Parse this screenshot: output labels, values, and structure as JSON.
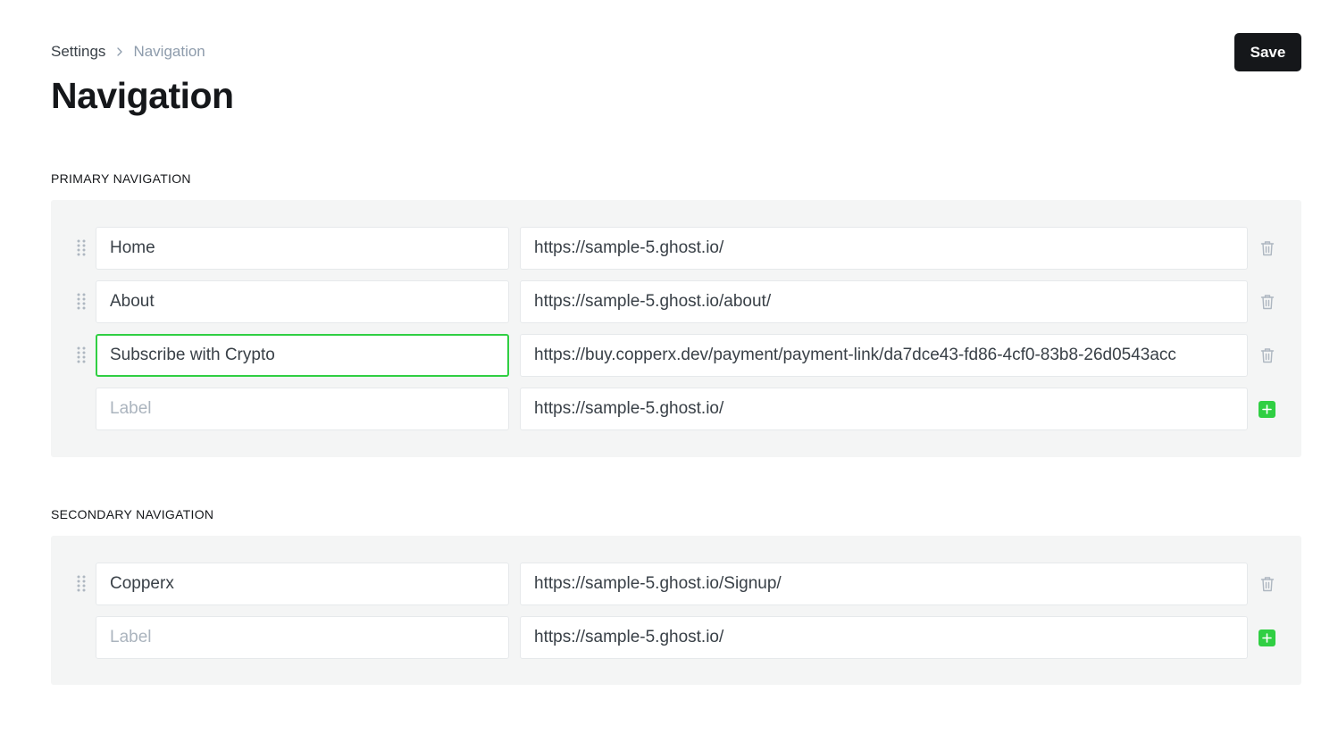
{
  "breadcrumb": {
    "root": "Settings",
    "current": "Navigation"
  },
  "page": {
    "title": "Navigation",
    "save_label": "Save"
  },
  "primary": {
    "heading": "PRIMARY NAVIGATION",
    "items": [
      {
        "label": "Home",
        "url": "https://sample-5.ghost.io/"
      },
      {
        "label": "About",
        "url": "https://sample-5.ghost.io/about/"
      },
      {
        "label": "Subscribe with Crypto",
        "url": "https://buy.copperx.dev/payment/payment-link/da7dce43-fd86-4cf0-83b8-26d0543acc"
      }
    ],
    "new_item": {
      "label_placeholder": "Label",
      "url": "https://sample-5.ghost.io/"
    }
  },
  "secondary": {
    "heading": "SECONDARY NAVIGATION",
    "items": [
      {
        "label": "Copperx",
        "url": "https://sample-5.ghost.io/Signup/"
      }
    ],
    "new_item": {
      "label_placeholder": "Label",
      "url": "https://sample-5.ghost.io/"
    }
  },
  "colors": {
    "accent_green": "#30cf43",
    "dark": "#15171a",
    "panel_bg": "#f4f5f5"
  },
  "icons": {
    "drag": "drag-handle-icon",
    "delete": "trash-icon",
    "add": "plus-icon",
    "separator": "chevron-right-icon"
  }
}
